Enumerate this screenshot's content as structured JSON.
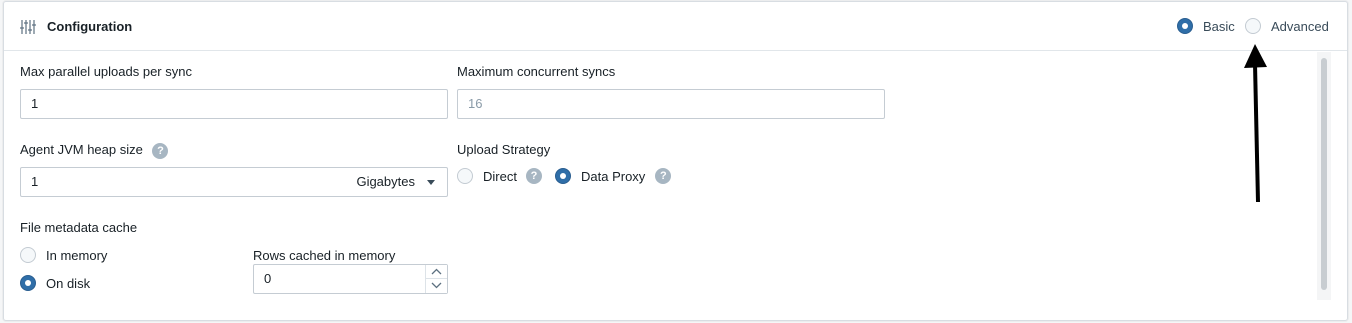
{
  "header": {
    "title": "Configuration",
    "icon": "sliders-icon",
    "mode_options": [
      {
        "label": "Basic",
        "selected": true
      },
      {
        "label": "Advanced",
        "selected": false
      }
    ]
  },
  "fields": {
    "max_parallel_uploads": {
      "label": "Max parallel uploads per sync",
      "value": "1"
    },
    "max_concurrent_syncs": {
      "label": "Maximum concurrent syncs",
      "placeholder": "16"
    },
    "jvm_heap": {
      "label": "Agent JVM heap size",
      "help_icon": "help-icon",
      "value": "1",
      "unit": "Gigabytes"
    },
    "upload_strategy": {
      "label": "Upload Strategy",
      "options": [
        {
          "label": "Direct",
          "selected": false
        },
        {
          "label": "Data Proxy",
          "selected": true
        }
      ]
    },
    "file_metadata_cache": {
      "label": "File metadata cache",
      "options": [
        {
          "label": "In memory",
          "selected": false
        },
        {
          "label": "On disk",
          "selected": true
        }
      ]
    },
    "rows_cached": {
      "label": "Rows cached in memory",
      "value": "0"
    }
  },
  "colors": {
    "accent": "#2f6ea8",
    "border": "#c5ccd3",
    "help": "#a7b6c2"
  }
}
